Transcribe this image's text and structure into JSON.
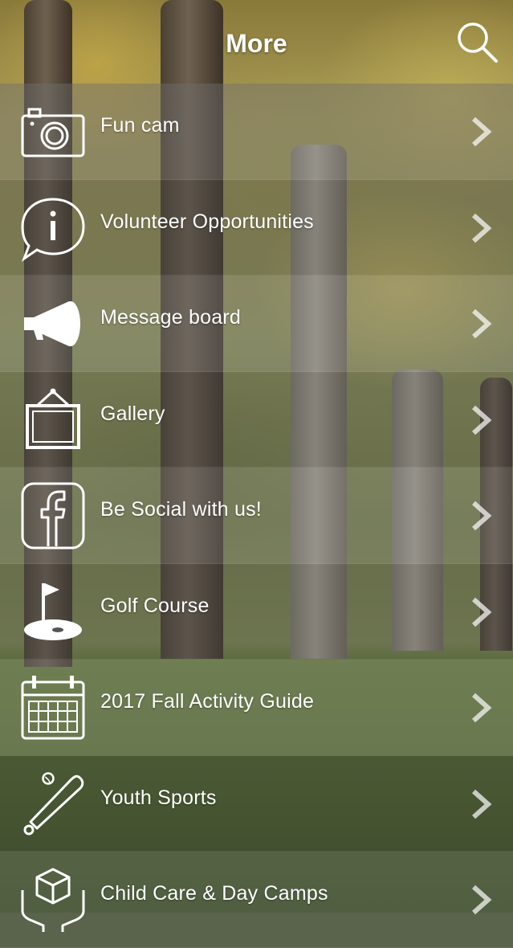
{
  "header": {
    "title": "More",
    "search_icon": "search-icon"
  },
  "menu": {
    "items": [
      {
        "label": "Fun cam",
        "icon": "camera-icon"
      },
      {
        "label": "Volunteer Opportunities",
        "icon": "info-bubble-icon"
      },
      {
        "label": "Message board",
        "icon": "megaphone-icon"
      },
      {
        "label": "Gallery",
        "icon": "picture-frame-icon"
      },
      {
        "label": "Be Social with us!",
        "icon": "facebook-icon"
      },
      {
        "label": "Golf Course",
        "icon": "golf-flag-icon"
      },
      {
        "label": "2017 Fall Activity Guide",
        "icon": "calendar-icon"
      },
      {
        "label": "Youth Sports",
        "icon": "baseball-bat-icon"
      },
      {
        "label": "Child Care & Day Camps",
        "icon": "hands-box-icon"
      }
    ],
    "chevron_icon": "chevron-right-icon"
  },
  "colors": {
    "text": "#ffffff",
    "row_light": "rgba(110,110,110,0.45)",
    "row_dark": "rgba(70,70,70,0.42)"
  }
}
